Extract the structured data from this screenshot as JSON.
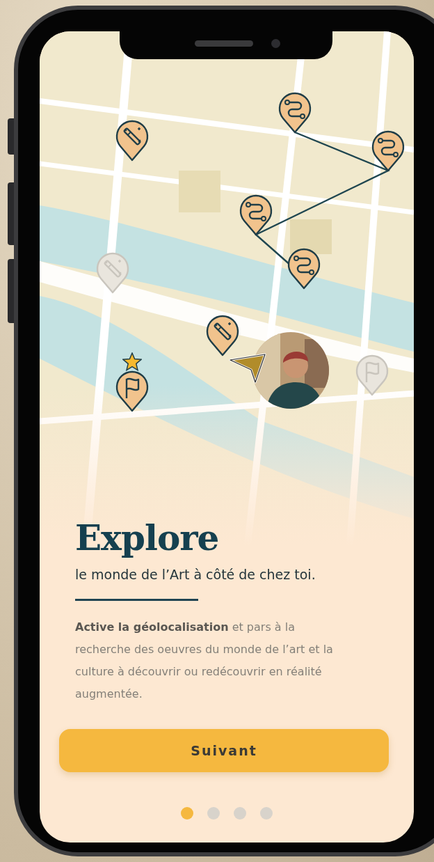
{
  "map": {
    "pins": [
      {
        "kind": "route",
        "disabled": false,
        "starred": false
      },
      {
        "kind": "route",
        "disabled": false,
        "starred": false
      },
      {
        "kind": "route",
        "disabled": false,
        "starred": false
      },
      {
        "kind": "route",
        "disabled": false,
        "starred": false
      },
      {
        "kind": "wand",
        "disabled": false,
        "starred": false
      },
      {
        "kind": "wand",
        "disabled": true,
        "starred": false
      },
      {
        "kind": "wand",
        "disabled": false,
        "starred": false
      },
      {
        "kind": "flag",
        "disabled": false,
        "starred": true
      },
      {
        "kind": "flag",
        "disabled": true,
        "starred": false
      }
    ]
  },
  "title": "Explore",
  "subtitle": "le monde de l’Art à côté de chez toi.",
  "description": "**Active la géolocalisation** et pars à la recherche des oeuvres du monde de l’art et la culture à découvrir ou redécouvrir en réalité augmentée.",
  "button": "Suivant",
  "pager": [
    {
      "selected": true
    },
    {
      "selected": false
    },
    {
      "selected": false
    },
    {
      "selected": false
    }
  ]
}
